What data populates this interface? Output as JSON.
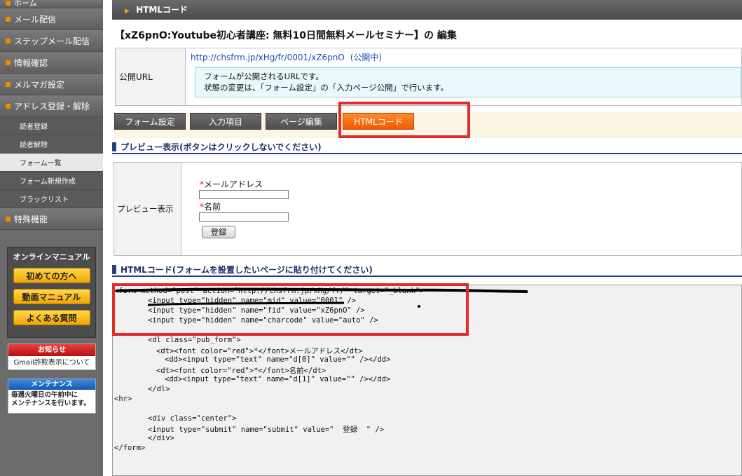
{
  "sidebar": {
    "top_item": "ホーム",
    "items": [
      "メール配信",
      "ステップメール配信",
      "情報確認",
      "メルマガ設定",
      "アドレス登録・解除"
    ],
    "sub_items": [
      "読者登録",
      "読者解除",
      "フォーム一覧",
      "フォーム新規作成",
      "ブラックリスト"
    ],
    "extra_item": "特殊機能",
    "manual": {
      "title": "オンラインマニュアル",
      "buttons": [
        "初めての方へ",
        "動画マニュアル",
        "よくある質問"
      ]
    },
    "notice": {
      "title": "お知らせ",
      "text": "Gmail詐欺表示について"
    },
    "maintenance": {
      "title": "メンテナンス",
      "line1": "毎週火曜日の午前中に",
      "line2": "メンテナンスを行います。"
    }
  },
  "header": {
    "title": "HTMLコード"
  },
  "page_title": "【xZ6pnO:Youtube初心者講座: 無料10日間無料メールセミナー】の 編集",
  "public_url": {
    "label": "公開URL",
    "url": "http://chsfrm.jp/xHg/fr/0001/xZ6pnO",
    "status": "(公開中)",
    "note_line1": "フォームが公開されるURLです。",
    "note_line2": "状態の変更は、「フォーム設定」の「入力ページ公開」で行います。"
  },
  "tabs": [
    "フォーム設定",
    "入力項目",
    "ページ編集",
    "HTMLコード"
  ],
  "preview_section": {
    "heading": "プレビュー表示(ボタンはクリックしないでください)",
    "label": "プレビュー表示",
    "field1_required": "*",
    "field1_label": "メールアドレス",
    "field2_required": "*",
    "field2_label": "名前",
    "submit_label": "登録"
  },
  "code_section": {
    "heading": "HTMLコード(フォームを設置したいページに貼り付けてください)",
    "lines": [
      "<form method=\"post\" action=\"http://chsfrm.jp/xHg/fr/\" target=\"_blank\">",
      "<input type=\"hidden\" name=\"mid\" value=\"0001\" />",
      "<input type=\"hidden\" name=\"fid\" value=\"xZ6pnO\" />",
      "<input type=\"hidden\" name=\"charcode\" value=\"auto\" />",
      "<dl class=\"pub_form\">",
      "<dt><font color=\"red\">*</font>メールアドレス</dt>",
      "<dd><input type=\"text\" name=\"d[0]\" value=\"\" /></dd>",
      "<dt><font color=\"red\">*</font>名前</dt>",
      "<dd><input type=\"text\" name=\"d[1]\" value=\"\" /></dd>",
      "</dl>",
      "<hr>",
      "<div class=\"center\">",
      "<input type=\"submit\" name=\"submit\" value=\"  登録  \" />",
      "</div>",
      "</form>"
    ]
  },
  "colors": {
    "accent": "#f05a00",
    "highlight": "#e52a2a",
    "link": "#1a4fb5"
  }
}
